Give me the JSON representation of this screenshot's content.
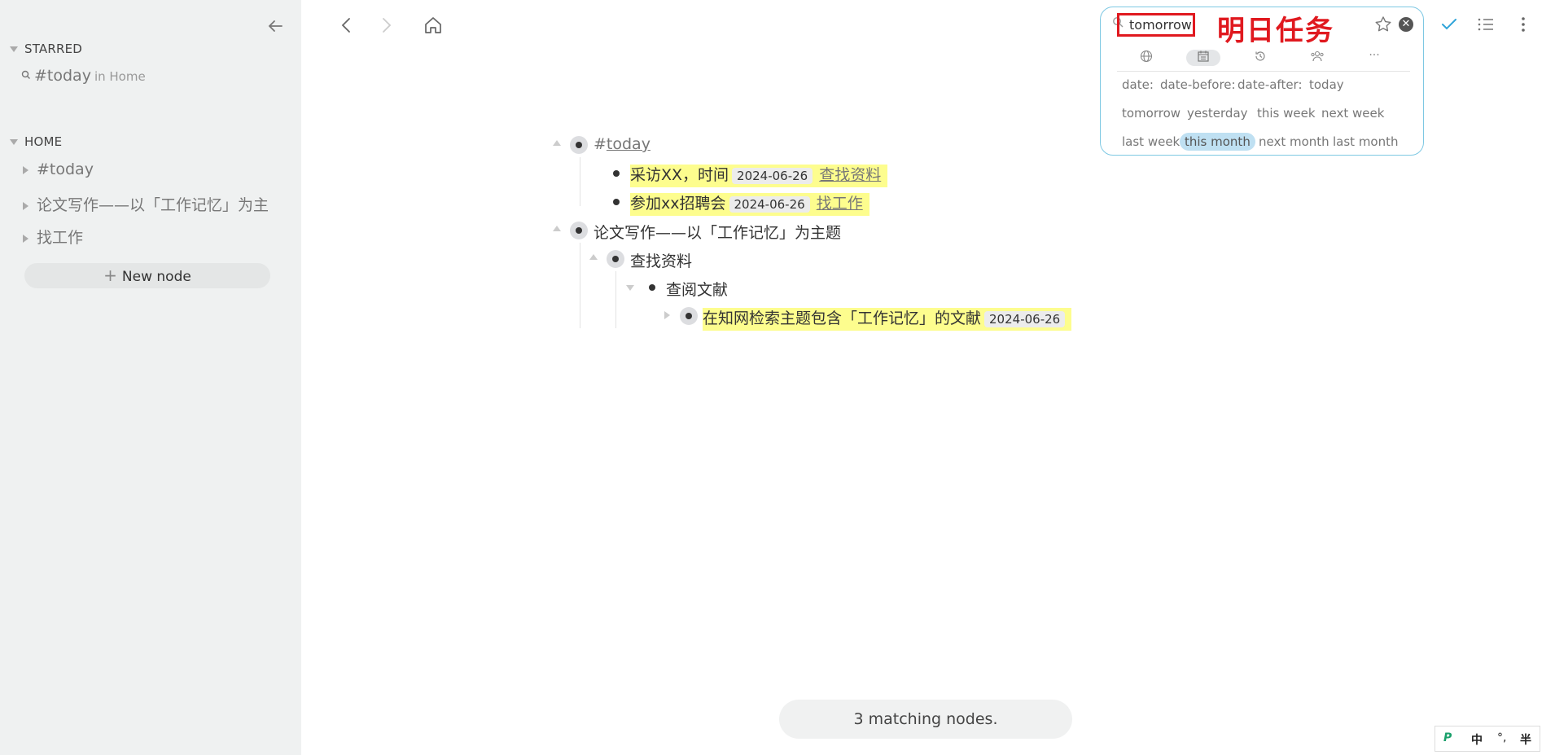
{
  "sidebar": {
    "starred_label": "STARRED",
    "starred_items": [
      {
        "label": "#today",
        "context": "in Home"
      }
    ],
    "home_label": "HOME",
    "home_items": [
      {
        "label": "#today"
      },
      {
        "label": "论文写作——以「工作记忆」为主"
      },
      {
        "label": "找工作"
      }
    ],
    "new_node_label": "New node"
  },
  "outline": {
    "root_tag": {
      "hash": "#",
      "label": "today"
    },
    "today_children": [
      {
        "text": "采访XX，时间",
        "date": "2024-06-26",
        "link": "查找资料"
      },
      {
        "text": "参加xx招聘会",
        "date": "2024-06-26",
        "link": "找工作"
      }
    ],
    "thesis": "论文写作——以「工作记忆」为主题",
    "search_material": "查找资料",
    "read_literature": "查阅文献",
    "task": {
      "text": "在知网检索主题包含「工作记忆」的文献",
      "date": "2024-06-26"
    }
  },
  "status": {
    "matching": "3 matching nodes."
  },
  "search": {
    "query": "tomorrow",
    "annotation": "明日任务",
    "filter_icons": [
      "globe-icon",
      "calendar-icon",
      "history-icon",
      "people-icon",
      "more-icon"
    ],
    "more_label": "···",
    "chips_row1": [
      "date:",
      "date-before:",
      "date-after:",
      "today"
    ],
    "chips_row2": [
      "tomorrow",
      "yesterday",
      "this week",
      "next week"
    ],
    "chips_row3": [
      "last week",
      "this month",
      "next month",
      "last month"
    ],
    "selected_chip": "this month"
  },
  "ime": {
    "logo": "P",
    "lang": "中",
    "punct": "°,",
    "width": "半"
  },
  "colors": {
    "accent": "#7ec8e3",
    "highlight": "#fdfd8e",
    "annotation": "#e0191f",
    "check": "#2fa4d9"
  }
}
